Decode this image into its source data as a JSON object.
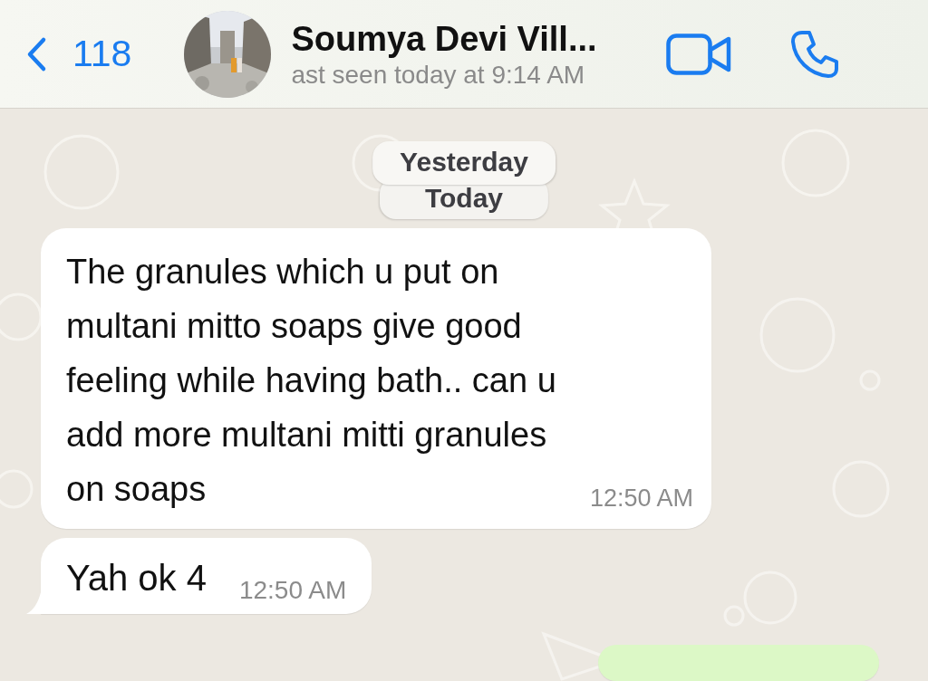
{
  "header": {
    "back_count": "118",
    "contact_name": "Soumya Devi Vill...",
    "status": "ast seen today at 9:14 AM"
  },
  "date_pills": [
    {
      "label": "Yesterday"
    },
    {
      "label": "Today"
    }
  ],
  "messages": [
    {
      "kind": "incoming",
      "text": "The granules which u put on multani mitto soaps give good feeling while having bath.. can u add more multani mitti granules on soaps",
      "time": "12:50 AM",
      "tail": false
    },
    {
      "kind": "incoming",
      "text": "Yah ok 4",
      "time": "12:50 AM",
      "tail": true
    },
    {
      "kind": "outgoing"
    }
  ]
}
